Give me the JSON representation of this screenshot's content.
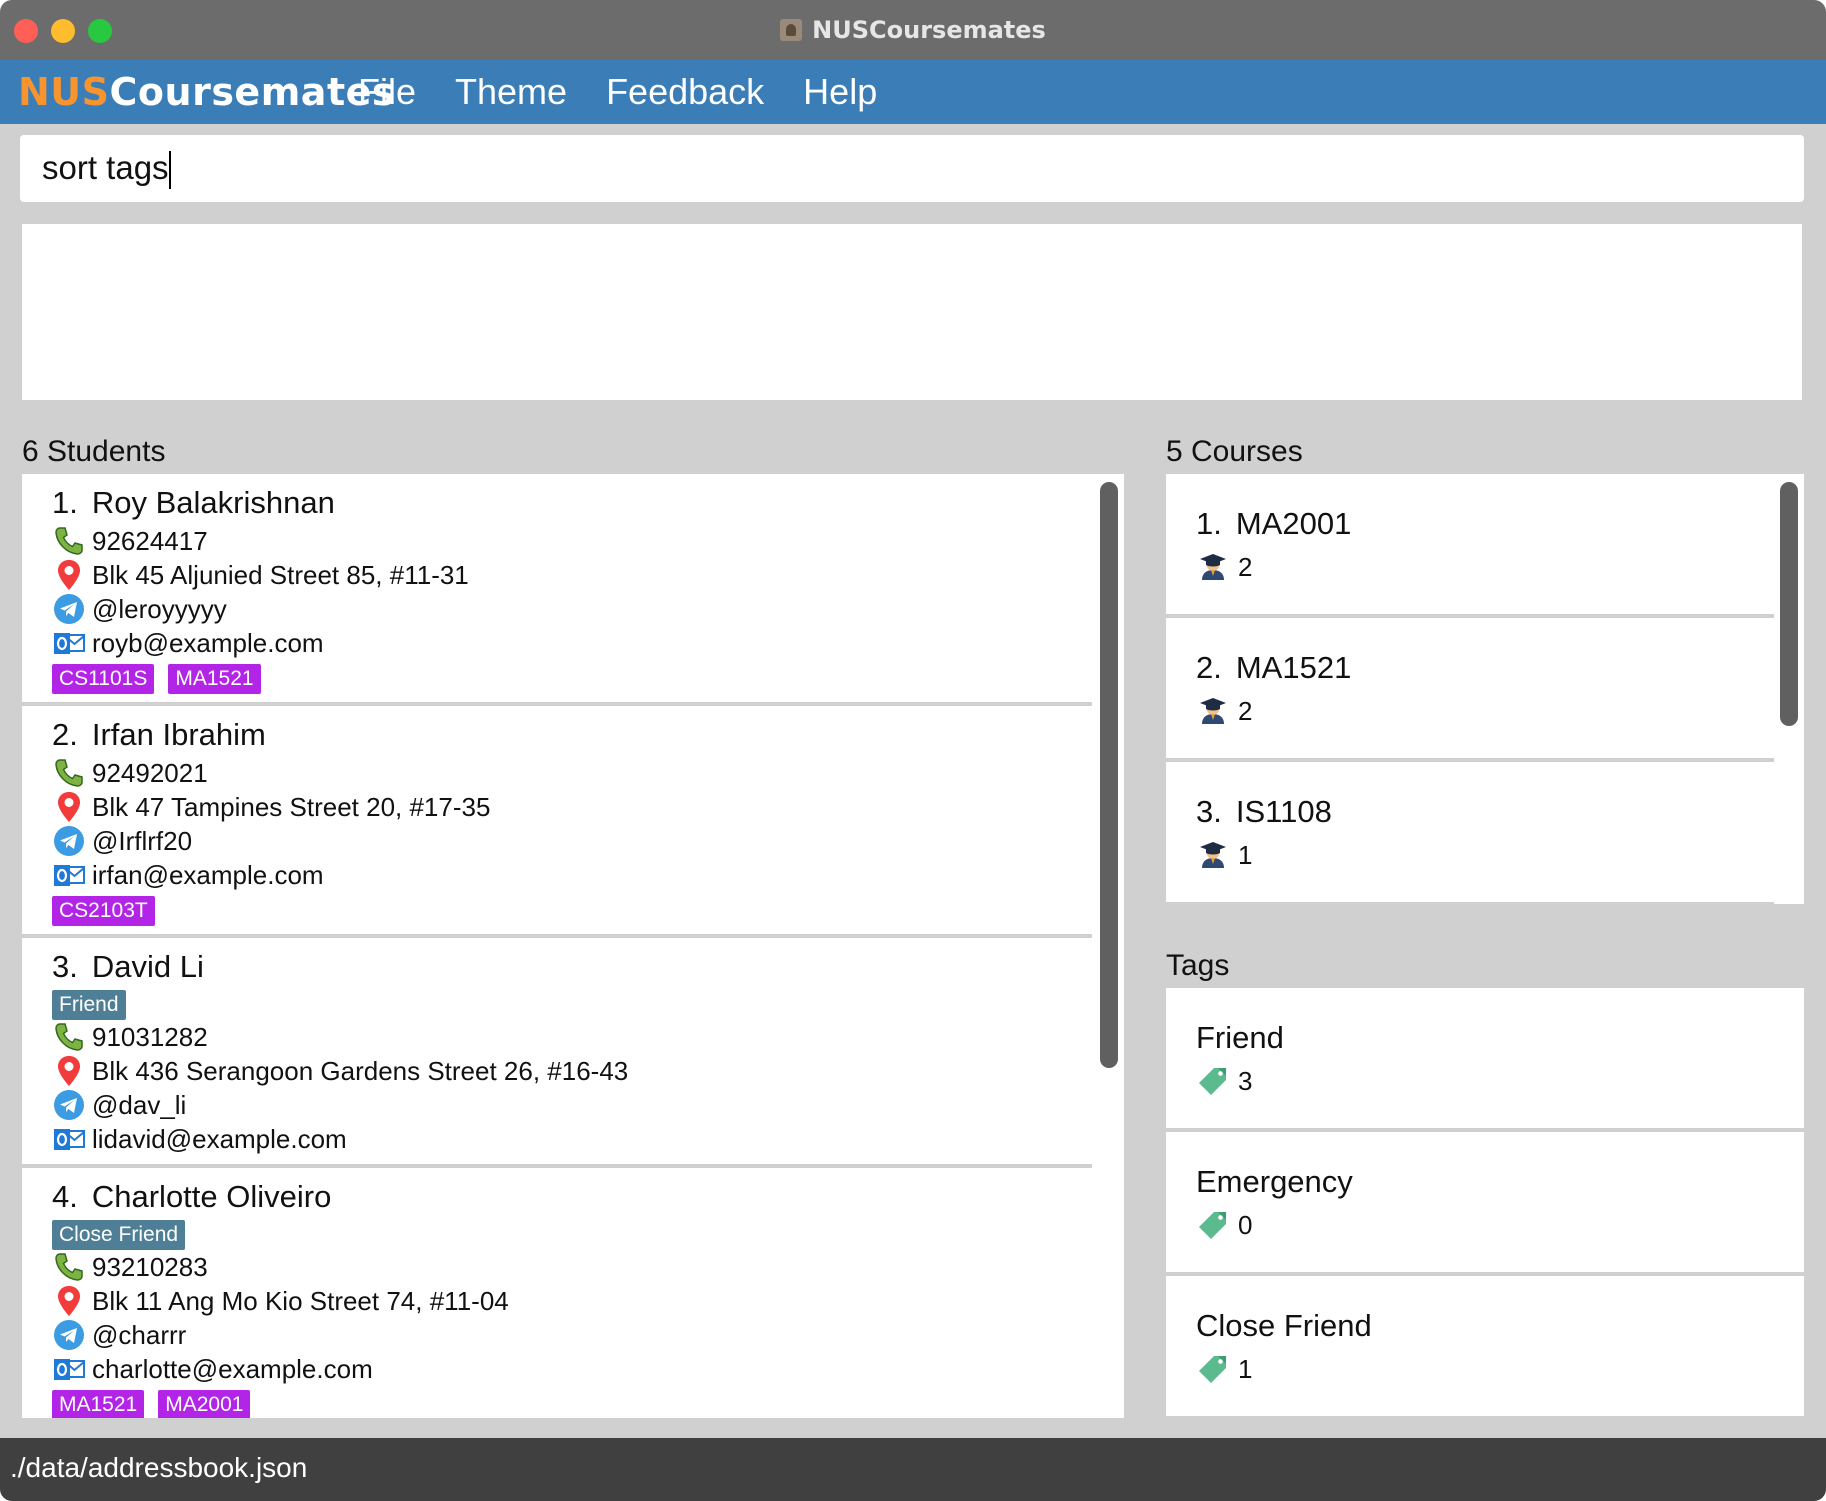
{
  "window": {
    "title": "NUSCoursemates"
  },
  "brand": {
    "part1": "NUS",
    "part2": "Coursemates"
  },
  "menu": [
    "File",
    "Theme",
    "Feedback",
    "Help"
  ],
  "command": {
    "value": "sort tags"
  },
  "result": {
    "text": ""
  },
  "students": {
    "header": "6 Students",
    "items": [
      {
        "index": "1.",
        "name": "Roy Balakrishnan",
        "labels": [],
        "phone": "92624417",
        "address": "Blk 45 Aljunied Street 85, #11-31",
        "telegram": "@leroyyyyy",
        "email": "royb@example.com",
        "courses": [
          "CS1101S",
          "MA1521"
        ]
      },
      {
        "index": "2.",
        "name": "Irfan Ibrahim",
        "labels": [],
        "phone": "92492021",
        "address": "Blk 47 Tampines Street 20, #17-35",
        "telegram": "@Irflrf20",
        "email": "irfan@example.com",
        "courses": [
          "CS2103T"
        ]
      },
      {
        "index": "3.",
        "name": "David Li",
        "labels": [
          "Friend"
        ],
        "phone": "91031282",
        "address": "Blk 436 Serangoon Gardens Street 26, #16-43",
        "telegram": "@dav_li",
        "email": "lidavid@example.com",
        "courses": []
      },
      {
        "index": "4.",
        "name": "Charlotte Oliveiro",
        "labels": [
          "Close Friend"
        ],
        "phone": "93210283",
        "address": "Blk 11 Ang Mo Kio Street 74, #11-04",
        "telegram": "@charrr",
        "email": "charlotte@example.com",
        "courses": [
          "MA1521",
          "MA2001"
        ]
      }
    ]
  },
  "courses": {
    "header": "5 Courses",
    "items": [
      {
        "index": "1.",
        "code": "MA2001",
        "count": "2"
      },
      {
        "index": "2.",
        "code": "MA1521",
        "count": "2"
      },
      {
        "index": "3.",
        "code": "IS1108",
        "count": "1"
      }
    ]
  },
  "tags": {
    "header": "Tags",
    "items": [
      {
        "name": "Friend",
        "count": "3"
      },
      {
        "name": "Emergency",
        "count": "0"
      },
      {
        "name": "Close Friend",
        "count": "1"
      }
    ]
  },
  "status": {
    "path": "./data/addressbook.json"
  },
  "colors": {
    "menubar": "#3a7db7",
    "brand_accent": "#f7942e",
    "course_tag": "#b325e6",
    "label_tag": "#4f7f96",
    "statusbar": "#404040"
  },
  "icons": {
    "phone": "phone-icon",
    "address": "location-pin-icon",
    "telegram": "telegram-icon",
    "email": "outlook-mail-icon",
    "student_count": "graduate-icon",
    "tag_count": "tag-icon"
  }
}
